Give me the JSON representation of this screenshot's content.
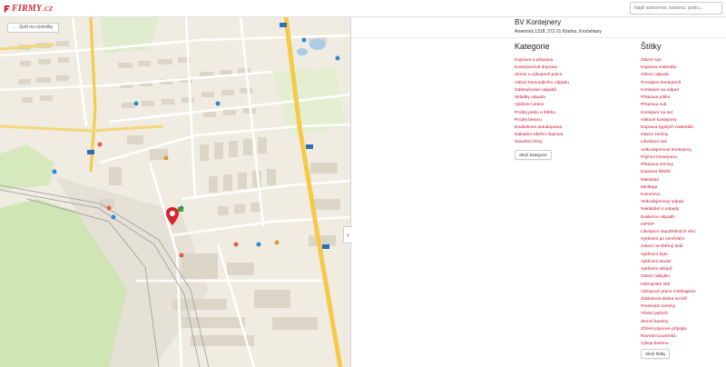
{
  "header": {
    "logo": "FIRMY",
    "logo_suffix": ".CZ",
    "search_placeholder": "Najdi autoservis, kavárnu, pošťu..."
  },
  "map": {
    "back_label": "Zpět na výsledky",
    "collapse_label": "›",
    "road_labels": {
      "r1": "10",
      "r2": "15",
      "r3": "10",
      "r4": "10",
      "r5": "25",
      "r6": "60"
    }
  },
  "firm": {
    "name": "BV Kontejnery",
    "address": "Americká 1318, 272 01 Kladno, Kročehlavy"
  },
  "categories": {
    "title": "Kategorie",
    "items": [
      "Doprava a přeprava",
      "Kontejnerová doprava",
      "Zemní a výkopové práce",
      "Odvoz komunálního odpadu",
      "Odstraňování odpadů",
      "Skládky odpadu",
      "Vyklízecí práce",
      "Prodej písku a štěrku",
      "Prodej betonu",
      "Dodávková autodoprava",
      "Nákladní silniční doprava",
      "Stavební firmy"
    ],
    "hide_button": "Skrýt kategorie"
  },
  "tags": {
    "title": "Štítky",
    "items": [
      "Odvoz suti",
      "Doprava materiálu",
      "Odvoz odpadu",
      "Pronájem kontejnerů",
      "Kontejner na odpad",
      "Přeprava písku",
      "Přeprava suti",
      "Kontejner na suť",
      "Hákové kontejnery",
      "Doprava sypkých materiálů",
      "Odvoz zeminy",
      "Likvidace suti",
      "Velkoobjemové kontejnery",
      "Půjčení kontejneru",
      "Přeprava zeminy",
      "Doprava štěrků",
      "Nakladač",
      "Minibagr",
      "Kamenivo",
      "Velkoobjemový odpad",
      "Nakládání s odpady",
      "Evidence odpadů",
      "ISPOP",
      "Likvidace nepotřebných věcí",
      "Vyklízení po zemřelém",
      "Odvoz na sběrný dvůr",
      "Vyklízení bytu",
      "Vyklízení stodol",
      "Vyklízení sklepů",
      "Odvoz nábytku",
      "Inženýrské sítě",
      "Výkopové práce minibagrem",
      "Základová deska na klíč",
      "Prosévání zeminy",
      "Trhání pařezů",
      "Zemní bazény",
      "Zřízení plynové přípojky",
      "Rovnání pozemků",
      "Výkop bazénu"
    ],
    "hide_button": "Skrýt štítky"
  },
  "colors": {
    "brand": "#d8262f",
    "link": "#c8102e",
    "map_bg": "#f0ece2",
    "road_major": "#f7c948",
    "forest": "#cfe5b4",
    "building": "#dcd6c8"
  }
}
